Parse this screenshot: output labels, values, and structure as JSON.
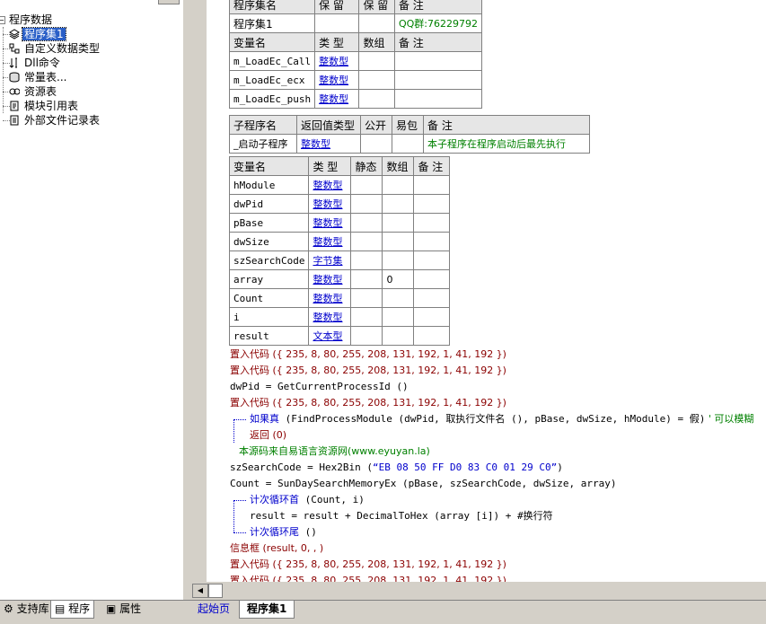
{
  "tree": {
    "root": "程序数据",
    "items": [
      {
        "label": "程序集1",
        "icon": "module-icon",
        "selected": true
      },
      {
        "label": "自定义数据类型",
        "icon": "data-type-icon"
      },
      {
        "label": "Dll命令",
        "icon": "dll-icon"
      },
      {
        "label": "常量表...",
        "icon": "constant-icon"
      },
      {
        "label": "资源表",
        "icon": "resource-icon"
      },
      {
        "label": "模块引用表",
        "icon": "module-ref-icon"
      },
      {
        "label": "外部文件记录表",
        "icon": "file-record-icon"
      }
    ]
  },
  "left_tabs": {
    "support": "支持库",
    "program": "程序",
    "properties": "属性"
  },
  "assembly_table": {
    "headers": [
      "程序集名",
      "保 留",
      "保 留",
      "备 注"
    ],
    "row": {
      "name": "程序集1",
      "note": "QQ群:76229792"
    },
    "var_headers": [
      "变量名",
      "类 型",
      "数组",
      "备 注"
    ],
    "vars": [
      {
        "name": "m_LoadEc_Call",
        "type": "整数型"
      },
      {
        "name": "m_LoadEc_ecx",
        "type": "整数型"
      },
      {
        "name": "m_LoadEc_push",
        "type": "整数型"
      }
    ]
  },
  "sub_table": {
    "headers": [
      "子程序名",
      "返回值类型",
      "公开",
      "易包",
      "备 注"
    ],
    "row": {
      "name": "_启动子程序",
      "type": "整数型",
      "note": "本子程序在程序启动后最先执行"
    }
  },
  "local_table": {
    "headers": [
      "变量名",
      "类 型",
      "静态",
      "数组",
      "备 注"
    ],
    "vars": [
      {
        "name": "hModule",
        "type": "整数型",
        "array": ""
      },
      {
        "name": "dwPid",
        "type": "整数型",
        "array": ""
      },
      {
        "name": "pBase",
        "type": "整数型",
        "array": ""
      },
      {
        "name": "dwSize",
        "type": "整数型",
        "array": ""
      },
      {
        "name": "szSearchCode",
        "type": "字节集",
        "array": ""
      },
      {
        "name": "array",
        "type": "整数型",
        "array": "0"
      },
      {
        "name": "Count",
        "type": "整数型",
        "array": ""
      },
      {
        "name": "i",
        "type": "整数型",
        "array": ""
      },
      {
        "name": "result",
        "type": "文本型",
        "array": ""
      }
    ]
  },
  "code": {
    "l1": "置入代码 ({ 235, 8, 80, 255, 208, 131, 192, 1, 41, 192 })",
    "l2": "置入代码 ({ 235, 8, 80, 255, 208, 131, 192, 1, 41, 192 })",
    "l3": "dwPid = GetCurrentProcessId ()",
    "l4": "置入代码 ({ 235, 8, 80, 255, 208, 131, 192, 1, 41, 192 })",
    "l5a": "如果真",
    "l5b": " (FindProcessModule (dwPid, 取执行文件名 (), pBase, dwSize, hModule) = 假)",
    "l5c": " ' 可以模糊",
    "l6": "返回 (0)",
    "l7": "本源码来自易语言资源网(www.eyuyan.la)",
    "l8a": "szSearchCode = Hex2Bin (",
    "l8b": "“EB 08 50 FF D0 83 C0 01 29 C0”",
    "l8c": ")",
    "l9": "Count = SunDaySearchMemoryEx (pBase, szSearchCode, dwSize, array)",
    "l10a": "计次循环首",
    "l10b": " (Count, i)",
    "l11": "result = result + DecimalToHex (array [i]) + #换行符",
    "l12a": "计次循环尾",
    "l12b": " ()",
    "l13": "信息框 (result, 0, , )",
    "l14": "置入代码 ({ 235, 8, 80, 255, 208, 131, 192, 1, 41, 192 })",
    "l15": "置入代码 ({ 235, 8, 80, 255, 208, 131, 192, 1, 41, 192 })"
  },
  "editor_tabs": {
    "home": "起始页",
    "active": "程序集1"
  },
  "colors": {
    "keyword": "#8b0000",
    "comment": "#008000",
    "type": "#0000cc",
    "selection": "#2a5fc7"
  }
}
